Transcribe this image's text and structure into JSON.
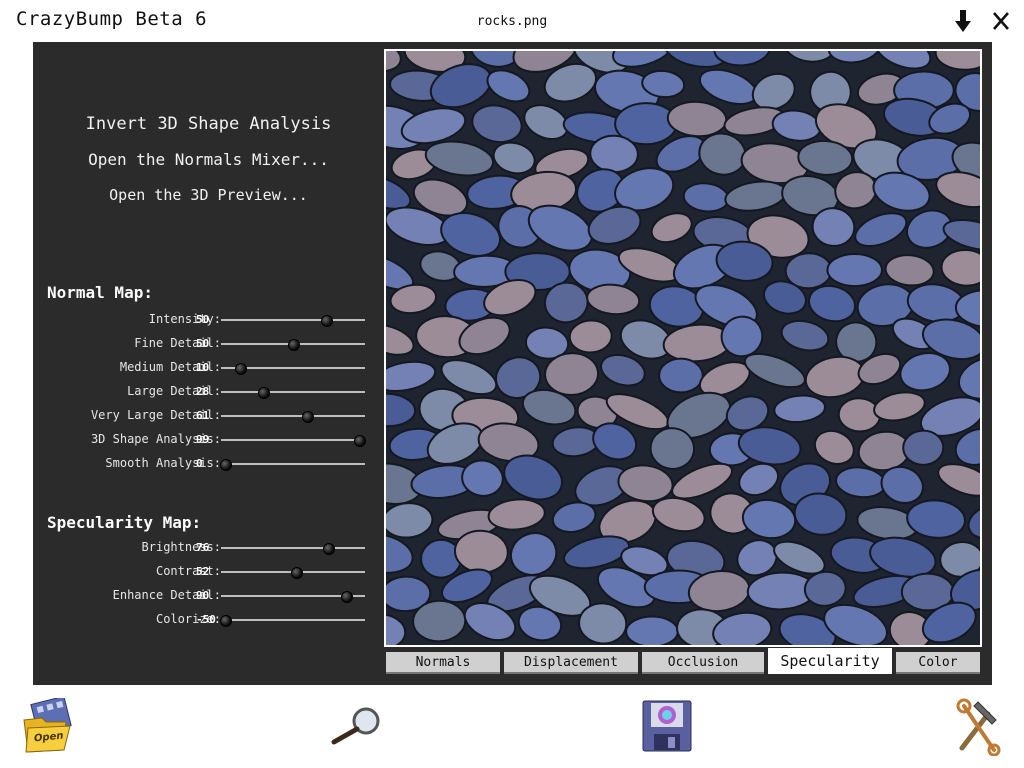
{
  "window": {
    "app_title": "CrazyBump Beta 6",
    "file_name": "rocks.png",
    "minimize_icon": "down-arrow-icon",
    "close_icon": "close-x-icon"
  },
  "menu": {
    "invert": "Invert 3D Shape Analysis",
    "mixer": "Open the Normals Mixer...",
    "preview": "Open the 3D Preview..."
  },
  "normal_map": {
    "title": "Normal Map:",
    "sliders": [
      {
        "label": "Intensity:",
        "value": "50",
        "level": 0.73
      },
      {
        "label": "Fine Detail:",
        "value": "50",
        "level": 0.5
      },
      {
        "label": "Medium Detail:",
        "value": "10",
        "level": 0.13
      },
      {
        "label": "Large Detail:",
        "value": "28",
        "level": 0.29
      },
      {
        "label": "Very Large Detail:",
        "value": "61",
        "level": 0.6
      },
      {
        "label": "3D Shape Analysis:",
        "value": "99",
        "level": 0.96
      },
      {
        "label": "Smooth Analysis:",
        "value": "0",
        "level": 0.03
      }
    ]
  },
  "specularity_map": {
    "title": "Specularity Map:",
    "sliders": [
      {
        "label": "Brightness:",
        "value": "76",
        "level": 0.74
      },
      {
        "label": "Contrast:",
        "value": "52",
        "level": 0.52
      },
      {
        "label": "Enhance Detail:",
        "value": "90",
        "level": 0.87
      },
      {
        "label": "Colorize:",
        "value": "-50",
        "level": 0.03
      }
    ]
  },
  "tabs": [
    {
      "label": "Normals",
      "active": false
    },
    {
      "label": "Displacement",
      "active": false
    },
    {
      "label": "Occlusion",
      "active": false
    },
    {
      "label": "Specularity",
      "active": true
    },
    {
      "label": "Color",
      "active": false
    }
  ],
  "toolbar": {
    "open_label": "Open",
    "open_icon": "open-folder-icon",
    "zoom_icon": "magnifier-icon",
    "save_icon": "floppy-disk-icon",
    "settings_icon": "tools-icon"
  },
  "colors": {
    "panel": "#2b2b2b",
    "rock_blue": "#5a6ea8",
    "rock_pink": "#9a8794"
  }
}
